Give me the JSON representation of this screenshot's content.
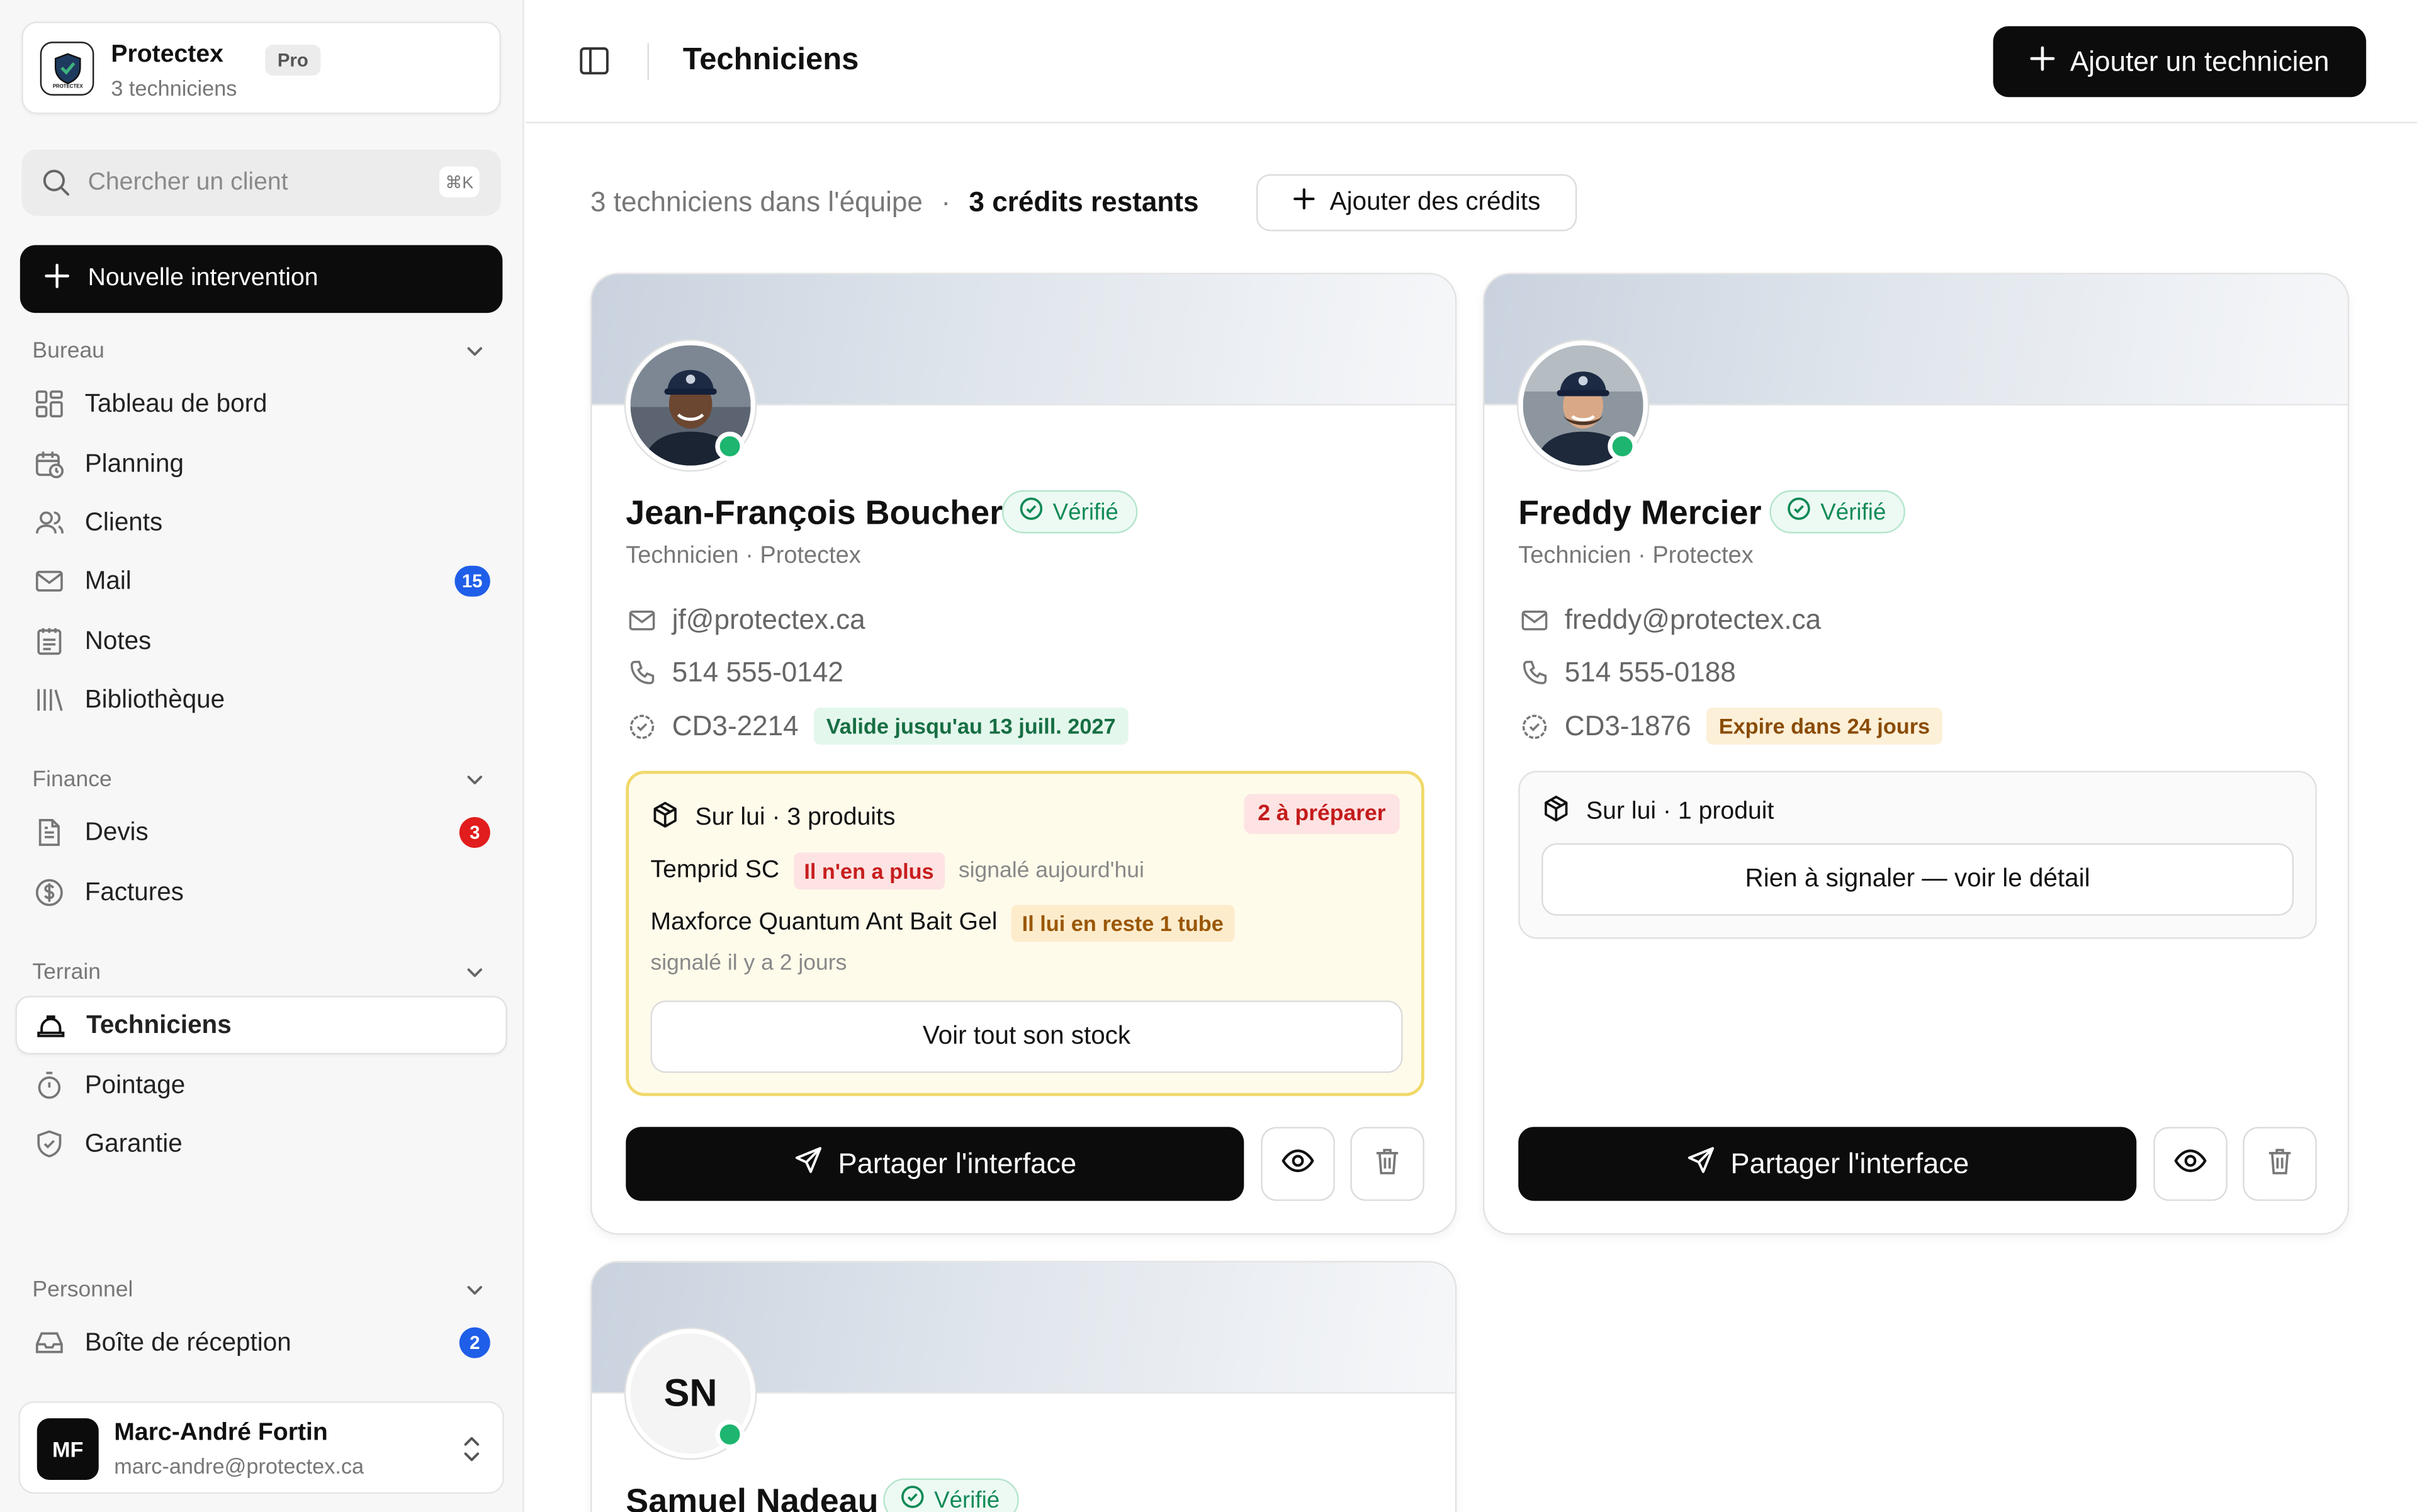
{
  "org": {
    "name": "Protectex",
    "plan": "Pro",
    "subtitle": "3 techniciens",
    "logo_text": "PROTECTEX"
  },
  "search": {
    "placeholder": "Chercher un client",
    "shortcut": "⌘K"
  },
  "new_intervention": "Nouvelle intervention",
  "sections": {
    "bureau": {
      "title": "Bureau",
      "items": [
        {
          "label": "Tableau de bord",
          "icon": "dashboard-icon"
        },
        {
          "label": "Planning",
          "icon": "calendar-clock-icon"
        },
        {
          "label": "Clients",
          "icon": "users-icon"
        },
        {
          "label": "Mail",
          "icon": "mail-icon",
          "badge": "15"
        },
        {
          "label": "Notes",
          "icon": "notepad-icon"
        },
        {
          "label": "Bibliothèque",
          "icon": "library-icon"
        }
      ]
    },
    "finance": {
      "title": "Finance",
      "items": [
        {
          "label": "Devis",
          "icon": "file-text-icon",
          "badge": "3"
        },
        {
          "label": "Factures",
          "icon": "dollar-circle-icon"
        }
      ]
    },
    "terrain": {
      "title": "Terrain",
      "items": [
        {
          "label": "Techniciens",
          "icon": "hard-hat-icon",
          "active": true
        },
        {
          "label": "Pointage",
          "icon": "timer-icon"
        },
        {
          "label": "Garantie",
          "icon": "shield-check-icon"
        }
      ]
    },
    "personnel": {
      "title": "Personnel",
      "items": [
        {
          "label": "Boîte de réception",
          "icon": "inbox-icon",
          "badge": "2"
        }
      ]
    }
  },
  "user": {
    "initials": "MF",
    "name": "Marc-André Fortin",
    "email": "marc-andre@protectex.ca"
  },
  "header": {
    "title": "Techniciens",
    "add_button": "Ajouter un technicien"
  },
  "summary": {
    "team": "3 techniciens dans l'équipe",
    "separator": "·",
    "credits": "3 crédits restants",
    "add_credits": "Ajouter des crédits"
  },
  "technicians": [
    {
      "name": "Jean-François Boucher",
      "verified": "Vérifié",
      "role": "Technicien · Protectex",
      "email": "jf@protectex.ca",
      "phone": "514 555-0142",
      "certificate": "CD3-2214",
      "cert_status": "Valide jusqu'au 13 juill. 2027",
      "stock": {
        "title": "Sur lui · 3 produits",
        "todo": "2 à préparer",
        "products": [
          {
            "name": "Temprid SC",
            "status": "Il n'en a plus",
            "when": "signalé aujourd'hui"
          },
          {
            "name": "Maxforce Quantum Ant Bait Gel",
            "status": "Il lui en reste 1 tube",
            "when": "signalé il y a 2 jours"
          }
        ],
        "button": "Voir tout son stock"
      },
      "share": "Partager l'interface"
    },
    {
      "name": "Freddy Mercier",
      "verified": "Vérifié",
      "role": "Technicien · Protectex",
      "email": "freddy@protectex.ca",
      "phone": "514 555-0188",
      "certificate": "CD3-1876",
      "cert_status": "Expire dans 24 jours",
      "stock": {
        "title": "Sur lui · 1 produit",
        "button": "Rien à signaler — voir le détail"
      },
      "share": "Partager l'interface"
    },
    {
      "initials": "SN",
      "name": "Samuel Nadeau",
      "verified": "Vérifié"
    }
  ],
  "colors": {
    "accent": "#0c0c0c",
    "online": "#1db56f",
    "badge_blue": "#1f5ee8",
    "badge_red": "#e11d1d",
    "verified_green": "#118a57"
  }
}
